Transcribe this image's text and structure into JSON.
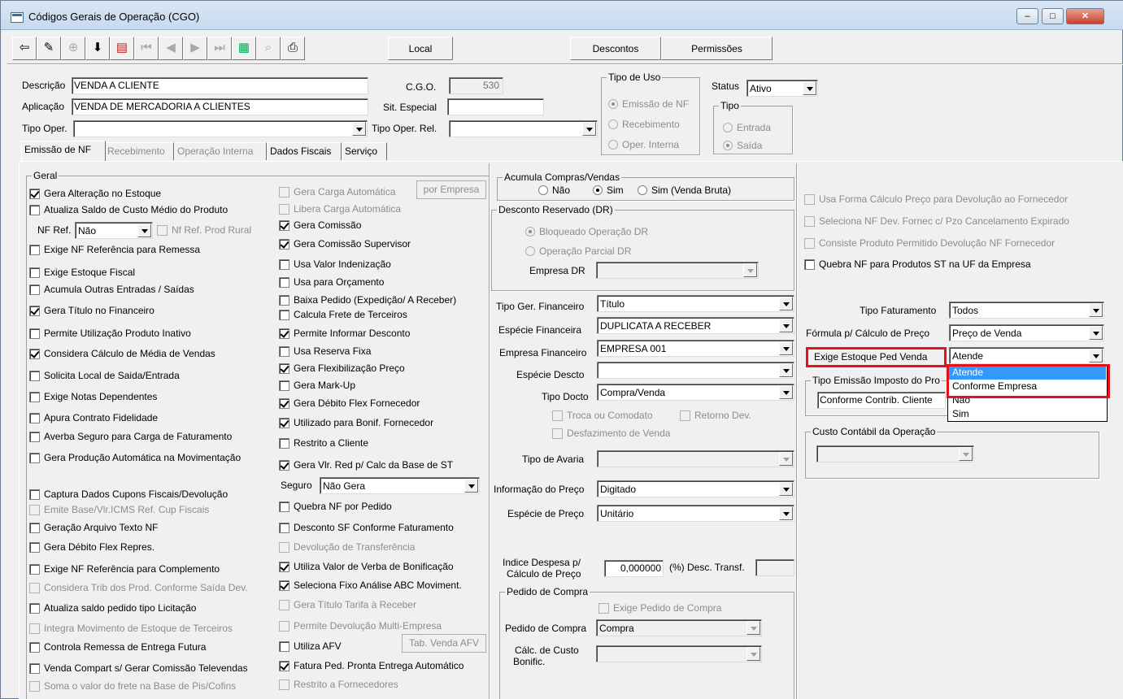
{
  "window": {
    "title": "Códigos Gerais de Operação (CGO)",
    "minimize_glyph": "–",
    "maximize_glyph": "□",
    "close_glyph": "✕"
  },
  "toolbar": {
    "icons": [
      "exit-door-icon",
      "edit-pencil-icon",
      "new-record-icon",
      "save-record-icon",
      "delete-record-icon",
      "first-record-icon",
      "prev-record-icon",
      "next-record-icon",
      "last-record-icon",
      "grid-view-icon",
      "binoculars-search-icon",
      "print-icon"
    ],
    "glyphs": [
      "⇦",
      "✎",
      "⊕",
      "⬇",
      "▤",
      "⏮",
      "◀",
      "▶",
      "⏭",
      "▦",
      "⌕",
      "⎙"
    ],
    "local_label": "Local",
    "descontos_label": "Descontos",
    "permissoes_label": "Permissões"
  },
  "header": {
    "descricao_label": "Descrição",
    "descricao_value": "VENDA A CLIENTE",
    "aplicacao_label": "Aplicação",
    "aplicacao_value": "VENDA DE MERCADORIA A CLIENTES",
    "tipo_oper_label": "Tipo Oper.",
    "tipo_oper_value": "",
    "cgo_label": "C.G.O.",
    "cgo_value": "530",
    "sit_especial_label": "Sit. Especial",
    "sit_especial_value": "",
    "tipo_oper_rel_label": "Tipo Oper. Rel.",
    "tipo_oper_rel_value": "",
    "tipo_uso": {
      "title": "Tipo de Uso",
      "options": [
        "Emissão de NF",
        "Recebimento",
        "Oper. Interna"
      ],
      "selected": 0
    },
    "status_label": "Status",
    "status_value": "Ativo",
    "tipo": {
      "title": "Tipo",
      "options": [
        "Entrada",
        "Saída"
      ],
      "selected": 1
    }
  },
  "tabs": [
    "Emissão de NF",
    "Recebimento",
    "Operação Interna",
    "Dados Fiscais",
    "Serviço"
  ],
  "geral": {
    "title": "Geral",
    "col1": [
      {
        "label": "Gera Alteração no Estoque",
        "checked": true,
        "enabled": true
      },
      {
        "label": "Atualiza Saldo de Custo Médio do Produto",
        "checked": false,
        "enabled": true
      },
      {
        "label": "Exige NF Referência para Remessa",
        "checked": false,
        "enabled": true
      },
      {
        "label": "Exige Estoque Fiscal",
        "checked": false,
        "enabled": true
      },
      {
        "label": "Acumula Outras Entradas / Saídas",
        "checked": false,
        "enabled": true
      },
      {
        "label": "Gera Título no Financeiro",
        "checked": true,
        "enabled": true
      },
      {
        "label": "Permite Utilização Produto Inativo",
        "checked": false,
        "enabled": true
      },
      {
        "label": "Considera Cálculo de Média de Vendas",
        "checked": true,
        "enabled": true
      },
      {
        "label": "Solicita Local de Saida/Entrada",
        "checked": false,
        "enabled": true
      },
      {
        "label": "Exige Notas Dependentes",
        "checked": false,
        "enabled": true
      },
      {
        "label": "Apura Contrato Fidelidade",
        "checked": false,
        "enabled": true
      },
      {
        "label": "Averba Seguro para Carga de Faturamento",
        "checked": false,
        "enabled": true
      },
      {
        "label": "Gera Produção Automática na Movimentação",
        "checked": false,
        "enabled": true
      },
      {
        "label": "Captura Dados Cupons Fiscais/Devolução",
        "checked": false,
        "enabled": true
      },
      {
        "label": "Emite Base/Vlr.ICMS Ref. Cup Fiscais",
        "checked": false,
        "enabled": false
      },
      {
        "label": "Geração Arquivo Texto NF",
        "checked": false,
        "enabled": true
      },
      {
        "label": "Gera Débito Flex Repres.",
        "checked": false,
        "enabled": true
      },
      {
        "label": "Exige NF Referência para Complemento",
        "checked": false,
        "enabled": true
      },
      {
        "label": "Considera Trib dos Prod. Conforme Saída Dev.",
        "checked": false,
        "enabled": false
      },
      {
        "label": "Atualiza saldo pedido tipo Licitação",
        "checked": false,
        "enabled": true
      },
      {
        "label": "Integra Movimento de Estoque de Terceiros",
        "checked": false,
        "enabled": false
      },
      {
        "label": "Controla Remessa de Entrega Futura",
        "checked": false,
        "enabled": true
      },
      {
        "label": "Venda Compart s/ Gerar Comissão Televendas",
        "checked": false,
        "enabled": true
      },
      {
        "label": "Soma o valor do frete na Base de Pis/Cofins",
        "checked": false,
        "enabled": false
      }
    ],
    "nf_ref_label": "NF Ref.",
    "nf_ref_value": "Não",
    "nf_ref_prod_rural_label": "Nf Ref. Prod Rural",
    "col2": [
      {
        "label": "Gera Carga Automática",
        "checked": false,
        "enabled": false
      },
      {
        "label": "Libera Carga Automática",
        "checked": false,
        "enabled": false
      },
      {
        "label": "Gera Comissão",
        "checked": true,
        "enabled": true
      },
      {
        "label": "Gera Comissão Supervisor",
        "checked": true,
        "enabled": true
      },
      {
        "label": "Usa Valor Indenização",
        "checked": false,
        "enabled": true
      },
      {
        "label": "Usa para Orçamento",
        "checked": false,
        "enabled": true
      },
      {
        "label": "Baixa Pedido (Expedição/ A Receber)",
        "checked": false,
        "enabled": true
      },
      {
        "label": "Calcula Frete de Terceiros",
        "checked": false,
        "enabled": true
      },
      {
        "label": "Permite Informar Desconto",
        "checked": true,
        "enabled": true
      },
      {
        "label": "Usa Reserva Fixa",
        "checked": false,
        "enabled": true
      },
      {
        "label": "Gera Flexibilização Preço",
        "checked": true,
        "enabled": true
      },
      {
        "label": "Gera Mark-Up",
        "checked": false,
        "enabled": true
      },
      {
        "label": "Gera Débito Flex Fornecedor",
        "checked": true,
        "enabled": true
      },
      {
        "label": "Utilizado para Bonif. Fornecedor",
        "checked": true,
        "enabled": true
      },
      {
        "label": "Restrito a Cliente",
        "checked": false,
        "enabled": true
      },
      {
        "label": "Gera Vlr. Red p/ Calc da Base de ST",
        "checked": true,
        "enabled": true
      },
      {
        "label": "Quebra NF por Pedido",
        "checked": false,
        "enabled": true
      },
      {
        "label": "Desconto SF Conforme Faturamento",
        "checked": false,
        "enabled": true
      },
      {
        "label": "Devolução de Transferência",
        "checked": false,
        "enabled": false
      },
      {
        "label": "Utiliza Valor de Verba de Bonificação",
        "checked": true,
        "enabled": true
      },
      {
        "label": "Seleciona Fixo Análise ABC Moviment.",
        "checked": true,
        "enabled": true
      },
      {
        "label": "Gera Título Tarifa à Receber",
        "checked": false,
        "enabled": false
      },
      {
        "label": "Permite Devolução Multi-Empresa",
        "checked": false,
        "enabled": false
      },
      {
        "label": "Utiliza AFV",
        "checked": false,
        "enabled": true
      },
      {
        "label": "Fatura Ped. Pronta Entrega Automático",
        "checked": true,
        "enabled": true
      },
      {
        "label": "Restrito a Fornecedores",
        "checked": false,
        "enabled": false
      }
    ],
    "por_empresa_label": "por Empresa",
    "tab_venda_afv_label": "Tab. Venda AFV",
    "seguro_label": "Seguro",
    "seguro_value": "Não Gera"
  },
  "middle": {
    "acumula_title": "Acumula Compras/Vendas",
    "acumula_options": [
      "Não",
      "Sim",
      "Sim (Venda Bruta)"
    ],
    "acumula_selected": 1,
    "dr_title": "Desconto Reservado (DR)",
    "dr_options": [
      "Bloqueado Operação DR",
      "Operação Parcial DR"
    ],
    "dr_selected": 0,
    "empresa_dr_label": "Empresa DR",
    "empresa_dr_value": "",
    "tipo_ger_fin_label": "Tipo Ger. Financeiro",
    "tipo_ger_fin_value": "Título",
    "especie_fin_label": "Espécie Financeira",
    "especie_fin_value": "DUPLICATA A RECEBER",
    "empresa_fin_label": "Empresa Financeiro",
    "empresa_fin_value": "EMPRESA 001",
    "especie_descto_label": "Espécie Descto",
    "especie_descto_value": "",
    "tipo_docto_label": "Tipo Docto",
    "tipo_docto_value": "Compra/Venda",
    "troca_label": "Troca ou Comodato",
    "retorno_label": "Retorno Dev.",
    "desfazimento_label": "Desfazimento de Venda",
    "tipo_avaria_label": "Tipo de Avaria",
    "tipo_avaria_value": "",
    "info_preco_label": "Informação do Preço",
    "info_preco_value": "Digitado",
    "especie_preco_label": "Espécie de Preço",
    "especie_preco_value": "Unitário",
    "indice_label_1": "Indice Despesa p/",
    "indice_label_2": "Cálculo de Preço",
    "indice_value": "0,000000",
    "desc_transf_label": "(%) Desc. Transf.",
    "desc_transf_value": "",
    "pedido_title": "Pedido de Compra",
    "exige_pedido_label": "Exige Pedido de Compra",
    "pedido_compra_label": "Pedido de Compra",
    "pedido_compra_value": "Compra",
    "calc_custo_label_1": "Cálc. de Custo",
    "calc_custo_label_2": "Bonific.",
    "calc_custo_value": ""
  },
  "right": {
    "checks": [
      {
        "label": "Usa Forma Cálculo Preço para Devolução ao Fornecedor",
        "checked": false,
        "enabled": false
      },
      {
        "label": "Seleciona NF Dev. Fornec c/ Pzo Cancelamento Expirado",
        "checked": false,
        "enabled": false
      },
      {
        "label": "Consiste Produto Permitido Devolução NF Fornecedor",
        "checked": false,
        "enabled": false
      },
      {
        "label": "Quebra NF para Produtos ST na UF da Empresa",
        "checked": false,
        "enabled": true
      }
    ],
    "tipo_fat_label": "Tipo Faturamento",
    "tipo_fat_value": "Todos",
    "formula_label": "Fórmula p/ Cálculo de Preço",
    "formula_value": "Preço de Venda",
    "exige_estoque_label": "Exige Estoque Ped Venda",
    "exige_estoque_value": "Atende",
    "tipo_emissao_title": "Tipo Emissão Imposto do Pro",
    "tipo_emissao_value": "Conforme Contrib. Cliente",
    "custo_title": "Custo Contábil da Operação",
    "custo_value": "",
    "dropdown_options": [
      "Atende",
      "Conforme Empresa",
      "Não",
      "Sim"
    ],
    "dropdown_selected": 0
  }
}
